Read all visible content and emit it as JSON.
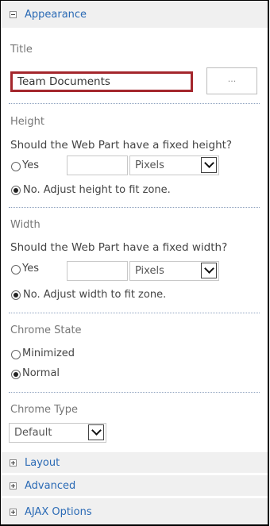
{
  "appearance": {
    "header": "Appearance"
  },
  "title": {
    "label": "Title",
    "value": "Team Documents",
    "builder_button": "..."
  },
  "height": {
    "label": "Height",
    "question": "Should the Web Part have a fixed height?",
    "yes_label": "Yes",
    "unit": "Pixels",
    "no_label": "No. Adjust height to fit zone."
  },
  "width": {
    "label": "Width",
    "question": "Should the Web Part have a fixed width?",
    "yes_label": "Yes",
    "unit": "Pixels",
    "no_label": "No. Adjust width to fit zone."
  },
  "chrome_state": {
    "label": "Chrome State",
    "minimized": "Minimized",
    "normal": "Normal",
    "selected": "Normal"
  },
  "chrome_type": {
    "label": "Chrome Type",
    "value": "Default"
  },
  "sections": [
    {
      "label": "Layout"
    },
    {
      "label": "Advanced"
    },
    {
      "label": "AJAX Options"
    }
  ],
  "colors": {
    "link": "#2a6ab5",
    "highlight_border": "#a4262c",
    "header_bg": "#f0f0f0"
  }
}
